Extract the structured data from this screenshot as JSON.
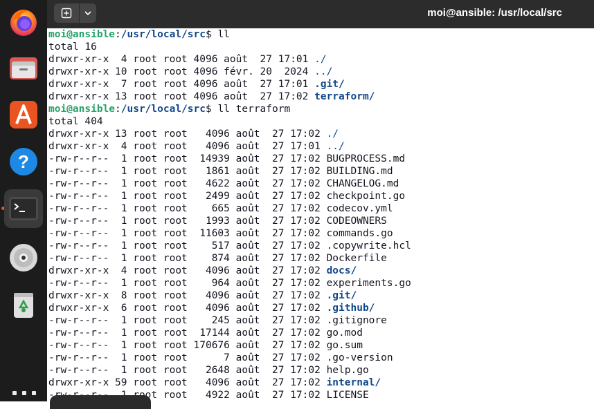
{
  "window": {
    "title": "moi@ansible: /usr/local/src"
  },
  "dock": {
    "apps": [
      {
        "name": "firefox",
        "icon": "firefox-icon"
      },
      {
        "name": "files",
        "icon": "files-icon"
      },
      {
        "name": "app-center",
        "icon": "app-center-icon"
      },
      {
        "name": "help",
        "icon": "help-icon"
      },
      {
        "name": "terminal",
        "icon": "terminal-icon",
        "active": true
      },
      {
        "name": "disc",
        "icon": "disc-icon"
      },
      {
        "name": "trash",
        "icon": "trash-icon"
      }
    ]
  },
  "terminal": {
    "prompt_user": "moi@ansible",
    "prompt_path": "/usr/local/src",
    "lines": [
      {
        "kind": "prompt",
        "cmd": " ll"
      },
      {
        "kind": "text",
        "text": "total 16"
      },
      {
        "kind": "entry",
        "meta": "drwxr-xr-x  4 root root 4096 août  27 17:01 ",
        "name": "./",
        "style": "dir"
      },
      {
        "kind": "entry",
        "meta": "drwxr-xr-x 10 root root 4096 févr. 20  2024 ",
        "name": "../",
        "style": "dir"
      },
      {
        "kind": "entry",
        "meta": "drwxr-xr-x  7 root root 4096 août  27 17:01 ",
        "name": ".git/",
        "style": "dirb"
      },
      {
        "kind": "entry",
        "meta": "drwxr-xr-x 13 root root 4096 août  27 17:02 ",
        "name": "terraform/",
        "style": "dirb"
      },
      {
        "kind": "prompt",
        "cmd": " ll terraform"
      },
      {
        "kind": "text",
        "text": "total 404"
      },
      {
        "kind": "entry",
        "meta": "drwxr-xr-x 13 root root   4096 août  27 17:02 ",
        "name": "./",
        "style": "dir"
      },
      {
        "kind": "entry",
        "meta": "drwxr-xr-x  4 root root   4096 août  27 17:01 ",
        "name": "../",
        "style": "dir"
      },
      {
        "kind": "entry",
        "meta": "-rw-r--r--  1 root root  14939 août  27 17:02 ",
        "name": "BUGPROCESS.md",
        "style": "file"
      },
      {
        "kind": "entry",
        "meta": "-rw-r--r--  1 root root   1861 août  27 17:02 ",
        "name": "BUILDING.md",
        "style": "file"
      },
      {
        "kind": "entry",
        "meta": "-rw-r--r--  1 root root   4622 août  27 17:02 ",
        "name": "CHANGELOG.md",
        "style": "file"
      },
      {
        "kind": "entry",
        "meta": "-rw-r--r--  1 root root   2499 août  27 17:02 ",
        "name": "checkpoint.go",
        "style": "file"
      },
      {
        "kind": "entry",
        "meta": "-rw-r--r--  1 root root    665 août  27 17:02 ",
        "name": "codecov.yml",
        "style": "file"
      },
      {
        "kind": "entry",
        "meta": "-rw-r--r--  1 root root   1993 août  27 17:02 ",
        "name": "CODEOWNERS",
        "style": "file"
      },
      {
        "kind": "entry",
        "meta": "-rw-r--r--  1 root root  11603 août  27 17:02 ",
        "name": "commands.go",
        "style": "file"
      },
      {
        "kind": "entry",
        "meta": "-rw-r--r--  1 root root    517 août  27 17:02 ",
        "name": ".copywrite.hcl",
        "style": "file"
      },
      {
        "kind": "entry",
        "meta": "-rw-r--r--  1 root root    874 août  27 17:02 ",
        "name": "Dockerfile",
        "style": "file"
      },
      {
        "kind": "entry",
        "meta": "drwxr-xr-x  4 root root   4096 août  27 17:02 ",
        "name": "docs/",
        "style": "dirb"
      },
      {
        "kind": "entry",
        "meta": "-rw-r--r--  1 root root    964 août  27 17:02 ",
        "name": "experiments.go",
        "style": "file"
      },
      {
        "kind": "entry",
        "meta": "drwxr-xr-x  8 root root   4096 août  27 17:02 ",
        "name": ".git/",
        "style": "dirb"
      },
      {
        "kind": "entry",
        "meta": "drwxr-xr-x  6 root root   4096 août  27 17:02 ",
        "name": ".github/",
        "style": "dirb"
      },
      {
        "kind": "entry",
        "meta": "-rw-r--r--  1 root root    245 août  27 17:02 ",
        "name": ".gitignore",
        "style": "file"
      },
      {
        "kind": "entry",
        "meta": "-rw-r--r--  1 root root  17144 août  27 17:02 ",
        "name": "go.mod",
        "style": "file"
      },
      {
        "kind": "entry",
        "meta": "-rw-r--r--  1 root root 170676 août  27 17:02 ",
        "name": "go.sum",
        "style": "file"
      },
      {
        "kind": "entry",
        "meta": "-rw-r--r--  1 root root      7 août  27 17:02 ",
        "name": ".go-version",
        "style": "file"
      },
      {
        "kind": "entry",
        "meta": "-rw-r--r--  1 root root   2648 août  27 17:02 ",
        "name": "help.go",
        "style": "file"
      },
      {
        "kind": "entry",
        "meta": "drwxr-xr-x 59 root root   4096 août  27 17:02 ",
        "name": "internal/",
        "style": "dirb"
      },
      {
        "kind": "entry",
        "meta": "-rw-r--r--  1 root root   4922 août  27 17:02 ",
        "name": "LICENSE",
        "style": "file"
      }
    ]
  },
  "colors": {
    "prompt_user": "#26a269",
    "prompt_path": "#12488b",
    "directory": "#12488b",
    "terminal_bg": "#ffffff",
    "terminal_fg": "#171421",
    "titlebar_bg": "#2c2c2c",
    "dock_bg": "#1c1c1c",
    "accent": "#e95420"
  }
}
